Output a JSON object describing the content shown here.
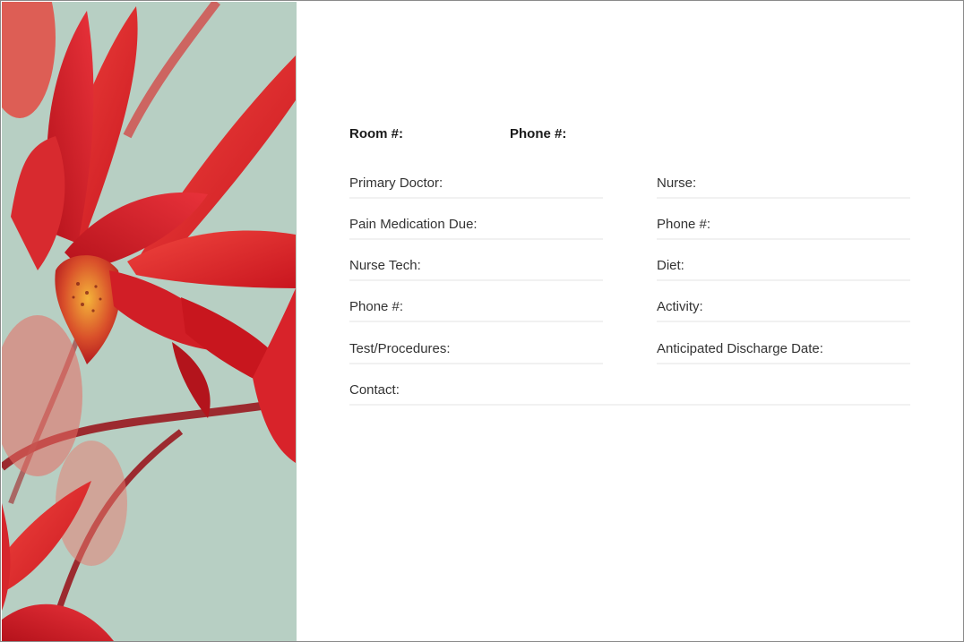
{
  "header": {
    "room_label": "Room #:",
    "phone_label": "Phone #:"
  },
  "fields": {
    "left": [
      {
        "label": "Primary Doctor:"
      },
      {
        "label": "Pain Medication Due:"
      },
      {
        "label": "Nurse Tech:"
      },
      {
        "label": "Phone #:"
      },
      {
        "label": "Test/Procedures:"
      },
      {
        "label": "Contact:"
      }
    ],
    "right": [
      {
        "label": "Nurse:"
      },
      {
        "label": "Phone #:"
      },
      {
        "label": "Diet:"
      },
      {
        "label": "Activity:"
      },
      {
        "label": "Anticipated Discharge Date:"
      }
    ]
  },
  "colors": {
    "photo_background": "#b7cfc3",
    "petal_red": "#e0252c",
    "petal_dark": "#b3141c",
    "stem": "#9c2a2f",
    "field_line": "#f1f1f1"
  },
  "image": {
    "semantic": "red-orchid-flowers-photo"
  }
}
